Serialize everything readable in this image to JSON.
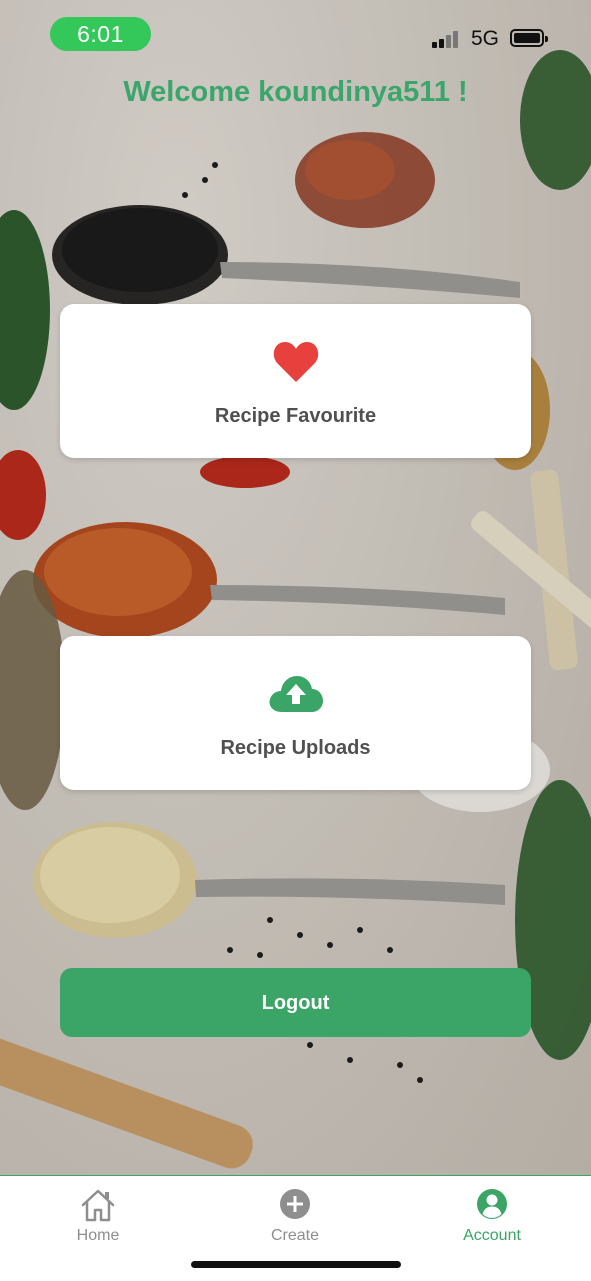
{
  "status_bar": {
    "time": "6:01",
    "network": "5G",
    "time_pill_color": "#34c759"
  },
  "header": {
    "welcome_text": "Welcome koundinya511 !",
    "color": "#3ba66b"
  },
  "cards": {
    "favourite": {
      "label": "Recipe Favourite",
      "icon": "heart-icon",
      "icon_color": "#e8403c"
    },
    "uploads": {
      "label": "Recipe Uploads",
      "icon": "cloud-upload-icon",
      "icon_color": "#3aa566"
    }
  },
  "logout": {
    "label": "Logout",
    "color": "#3aa566"
  },
  "tabs": [
    {
      "label": "Home",
      "icon": "home-icon",
      "active": false
    },
    {
      "label": "Create",
      "icon": "plus-circle-icon",
      "active": false
    },
    {
      "label": "Account",
      "icon": "account-icon",
      "active": true
    }
  ],
  "accent_color": "#3aa566"
}
